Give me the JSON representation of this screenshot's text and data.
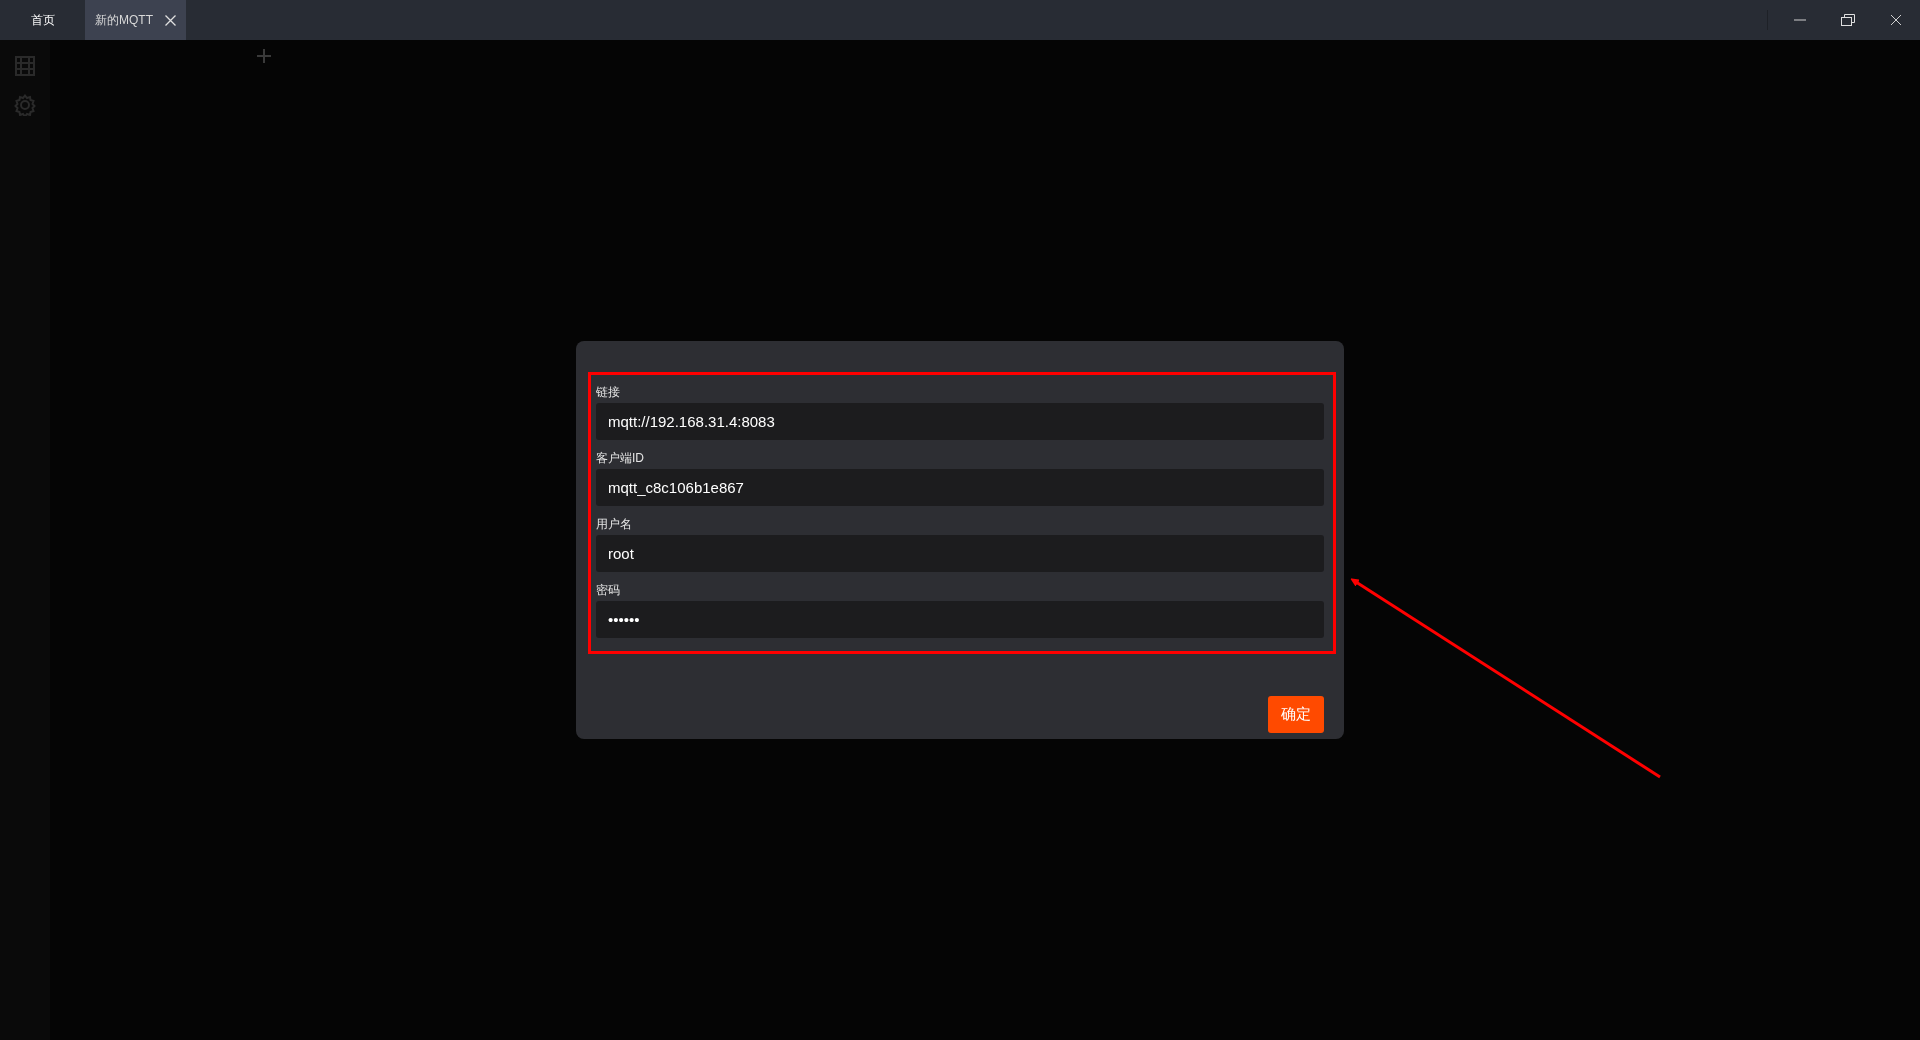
{
  "tabs": [
    {
      "label": "首页",
      "selected": false,
      "closable": false
    },
    {
      "label": "新的MQTT",
      "selected": true,
      "closable": true
    }
  ],
  "dialog": {
    "fields": [
      {
        "label": "链接",
        "value": "mqtt://192.168.31.4:8083"
      },
      {
        "label": "客户端ID",
        "value": "mqtt_c8c106b1e867"
      },
      {
        "label": "用户名",
        "value": "root"
      },
      {
        "label": "密码",
        "value": "••••••"
      }
    ],
    "confirm_button": "确定"
  }
}
